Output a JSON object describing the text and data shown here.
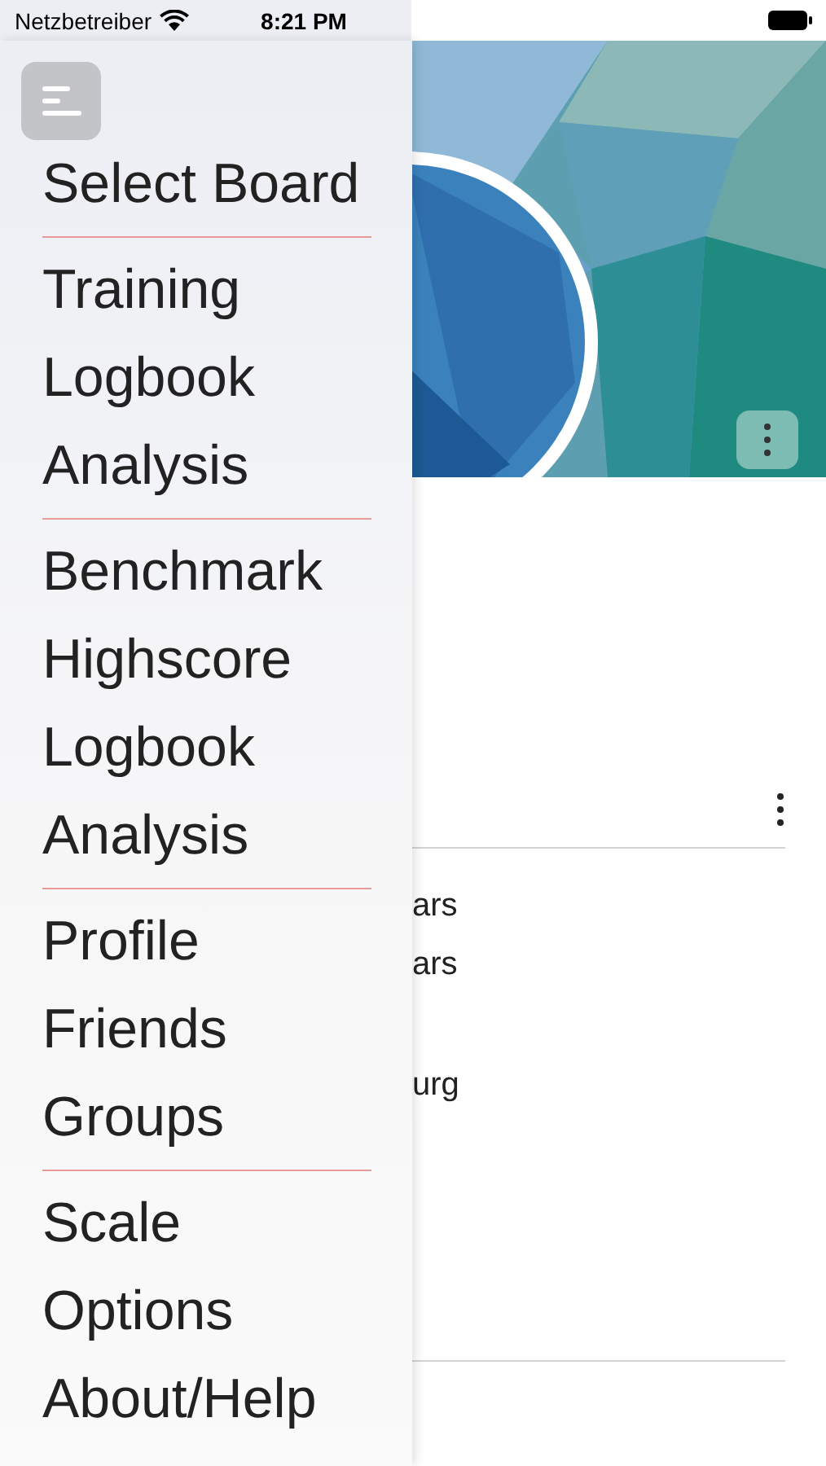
{
  "status_bar": {
    "carrier": "Netzbetreiber",
    "time": "8:21 PM"
  },
  "menu": {
    "groups": [
      {
        "items": [
          {
            "label": "Select Board"
          }
        ]
      },
      {
        "items": [
          {
            "label": "Training"
          },
          {
            "label": "Logbook"
          },
          {
            "label": "Analysis"
          }
        ]
      },
      {
        "items": [
          {
            "label": "Benchmark"
          },
          {
            "label": "Highscore"
          },
          {
            "label": "Logbook"
          },
          {
            "label": "Analysis"
          }
        ]
      },
      {
        "items": [
          {
            "label": "Profile"
          },
          {
            "label": "Friends"
          },
          {
            "label": "Groups"
          }
        ]
      },
      {
        "items": [
          {
            "label": "Scale"
          },
          {
            "label": "Options"
          },
          {
            "label": "About/Help"
          }
        ]
      }
    ]
  },
  "content": {
    "details": [
      {
        "text": "ars"
      },
      {
        "text": "ars"
      },
      {
        "text": "urg"
      }
    ]
  }
}
